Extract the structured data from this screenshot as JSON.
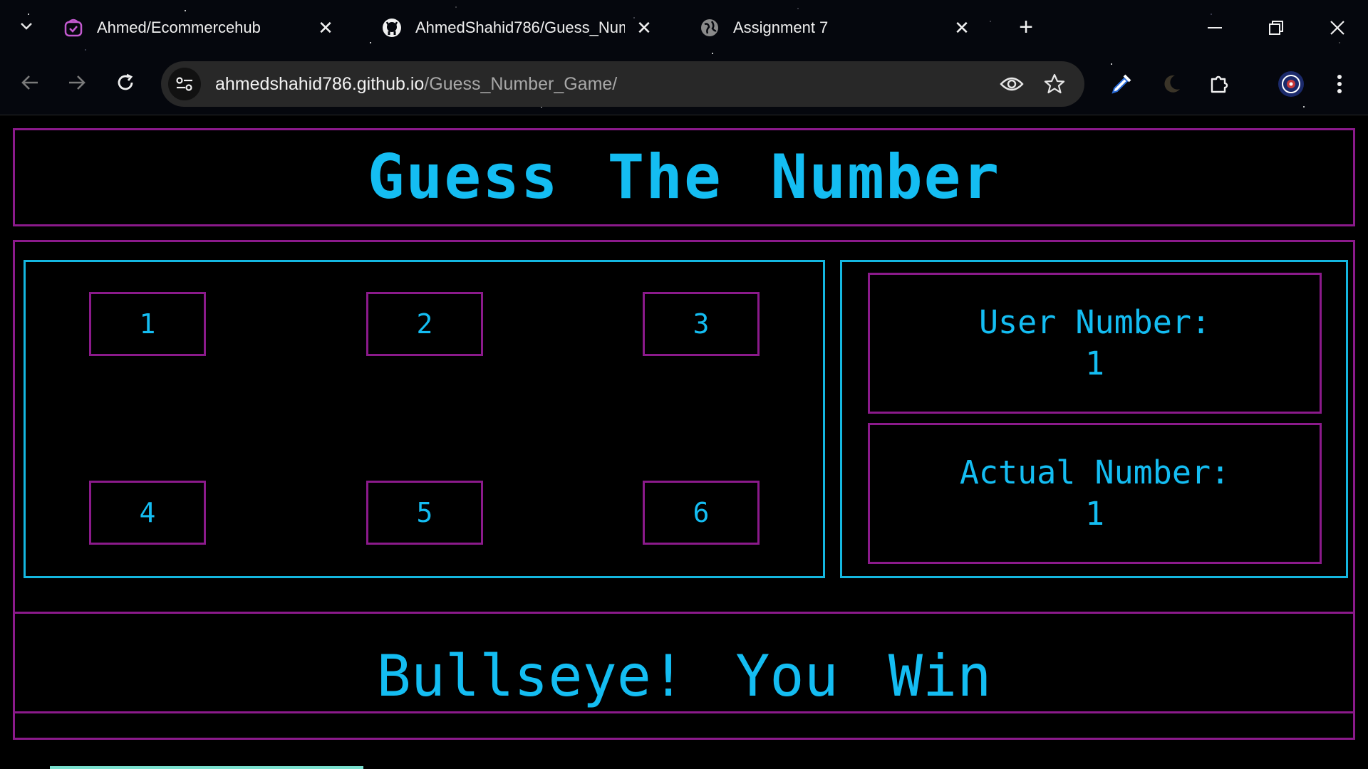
{
  "browser": {
    "tabs": [
      {
        "title": "Ahmed/Ecommercehub",
        "icon": "cart-badge-icon",
        "close": "✕"
      },
      {
        "title": "AhmedShahid786/Guess_Numb",
        "icon": "github-icon",
        "close": "✕"
      },
      {
        "title": "Assignment 7",
        "icon": "globe-icon",
        "close": "✕"
      }
    ],
    "new_tab": "+",
    "url_host": "ahmedshahid786.github.io",
    "url_path": "/Guess_Number_Game/"
  },
  "page": {
    "title": "Guess The Number",
    "number_buttons": [
      "1",
      "2",
      "3",
      "4",
      "5",
      "6"
    ],
    "user_number_label": "User Number:",
    "user_number_value": "1",
    "actual_number_label": "Actual Number:",
    "actual_number_value": "1",
    "result_message": "Bullseye! You Win"
  },
  "colors": {
    "accent_cyan": "#14bdf2",
    "border_magenta": "#8b1a8b",
    "panel_border_cyan": "#14b7e0",
    "background": "#000000"
  }
}
